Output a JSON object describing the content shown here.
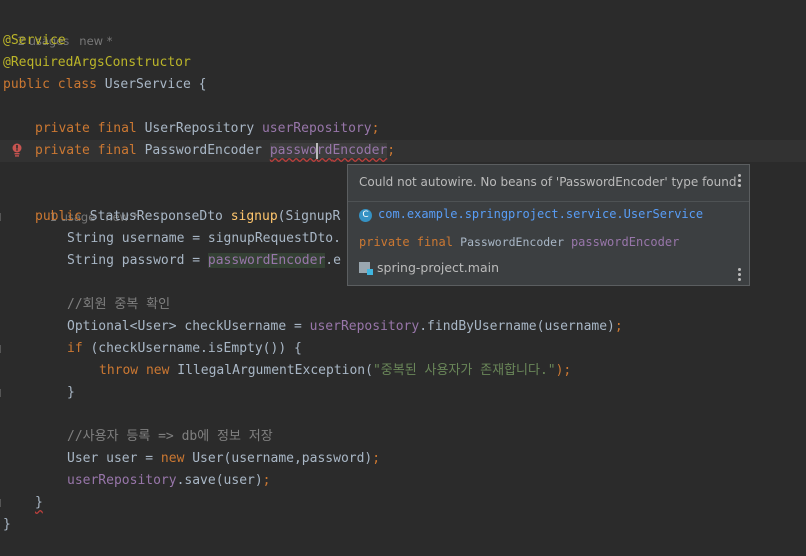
{
  "hints": {
    "class_usages": "2 usages",
    "class_new": "new *",
    "method_usages": "1 usage",
    "method_new": "new *"
  },
  "code": {
    "l_service": "@Service",
    "l_ctor": "@RequiredArgsConstructor",
    "l_class_kw": "public class ",
    "l_class_name": "UserService {",
    "l_repo_kw": "private final ",
    "l_repo_type": "UserRepository ",
    "l_repo_name": "userRepository",
    "l_repo_end": ";",
    "l_enc_kw": "private final ",
    "l_enc_type": "PasswordEncoder ",
    "l_enc_name_a": "passwo",
    "l_enc_name_b": "rd",
    "l_enc_name_c": "Encoder",
    "l_enc_end": ";",
    "l_sig_kw": "public ",
    "l_sig_type": "StatusResponseDto ",
    "l_sig_fn": "signup",
    "l_sig_rest": "(SignupR",
    "l_user_decl": "String username = signupRequestDto.",
    "l_pw_decl": "String password = ",
    "l_pw_field": "passwordEncoder",
    "l_pw_rest": ".e",
    "l_cmt1": "//회원 중복 확인",
    "l_opt_a": "Optional<User> checkUsername = ",
    "l_opt_field": "userRepository",
    "l_opt_b": ".findByUsername(username)",
    "l_opt_end": ";",
    "l_if_kw": "if ",
    "l_if_rest": "(checkUsername.isEmpty()) {",
    "l_throw_kw": "throw new ",
    "l_throw_cls": "IllegalArgumentException(",
    "l_throw_str": "\"중복된 사용자가 존재합니다.\"",
    "l_throw_end": ");",
    "l_close1": "}",
    "l_cmt2": "//사용자 등록 => db에 정보 저장",
    "l_new_a": "User user = ",
    "l_new_kw": "new ",
    "l_new_b": "User(username,password)",
    "l_new_end": ";",
    "l_save_field": "userRepository",
    "l_save_rest": ".save(user)",
    "l_save_end": ";",
    "l_close2": "}",
    "l_close3": "}"
  },
  "popup": {
    "message": "Could not autowire. No beans of 'PasswordEncoder' type found.",
    "class_icon": "C",
    "class_fqn": "com.example.springproject.service.UserService",
    "decl_kw": "private final ",
    "decl_type": "PasswordEncoder ",
    "decl_name": "passwordEncoder",
    "module": "spring-project.main"
  },
  "colors": {
    "background": "#2b2b2b",
    "keyword": "#cc7832",
    "annotation": "#bbb529",
    "field": "#9876aa",
    "method": "#ffc66d",
    "string": "#6a8759",
    "link": "#589df6"
  },
  "icons": {
    "gutter_warning": "warning-bulb-icon",
    "class_icon": "class-icon",
    "module_icon": "module-icon",
    "more": "more-vertical-icon"
  }
}
